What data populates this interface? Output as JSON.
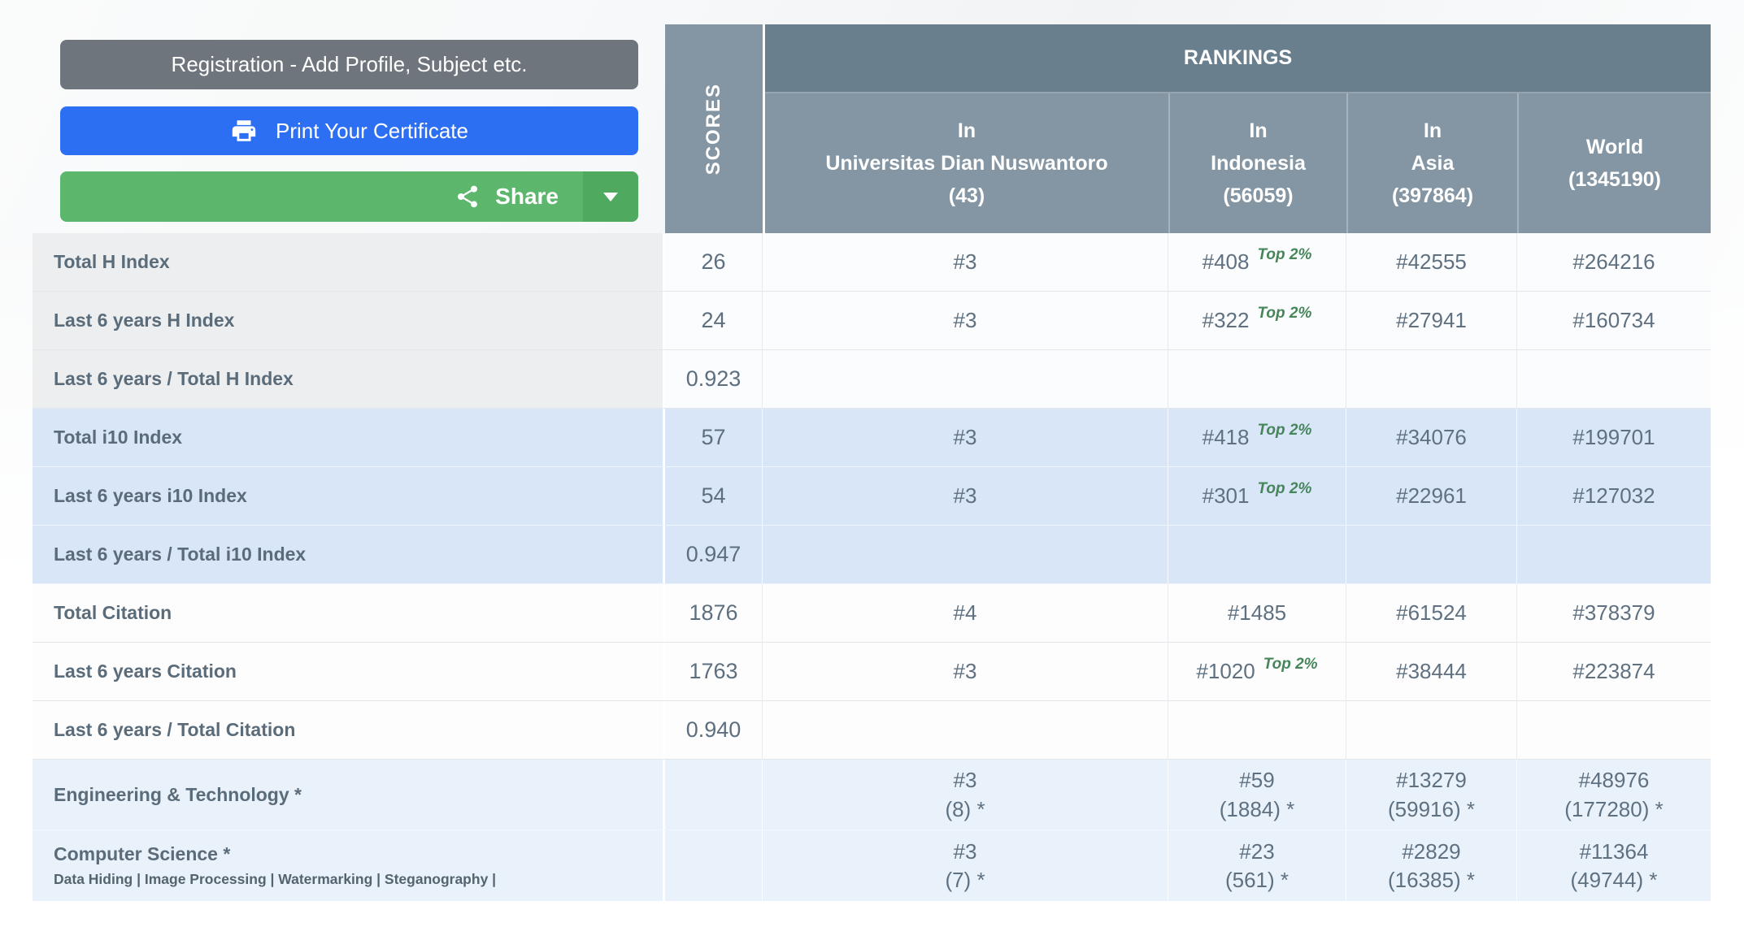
{
  "buttons": {
    "registration": "Registration - Add Profile, Subject etc.",
    "print": "Print Your Certificate",
    "share": "Share"
  },
  "icons": {
    "printer": "printer-icon",
    "share": "share-nodes-icon",
    "caret": "chevron-down-icon"
  },
  "colors": {
    "button_gray": "#6e757c",
    "button_blue": "#2c6ff2",
    "button_green": "#5cb66c",
    "button_green_dark": "#4fa95e",
    "header_dark_slate": "#6a7f8e",
    "header_light_slate": "#8496a3",
    "row_blue": "#d9e6f8",
    "row_light_blue": "#e9f1fb",
    "row_gray": "#eceef0",
    "badge_green": "#47855a",
    "text_slate": "#5a6b7a"
  },
  "table": {
    "scores_header": "SCORES",
    "rankings_header": "RANKINGS",
    "columns": [
      {
        "lines": [
          "In",
          "Universitas Dian Nuswantoro",
          "(43)"
        ]
      },
      {
        "lines": [
          "In",
          "Indonesia",
          "(56059)"
        ]
      },
      {
        "lines": [
          "In",
          "Asia",
          "(397864)"
        ]
      },
      {
        "lines": [
          "World",
          "(1345190)"
        ]
      }
    ],
    "rows": [
      {
        "group": "h",
        "label": "Total H Index",
        "score": "26",
        "cells": [
          {
            "rank": "#3"
          },
          {
            "rank": "#408",
            "badge": "Top 2%"
          },
          {
            "rank": "#42555"
          },
          {
            "rank": "#264216"
          }
        ]
      },
      {
        "group": "h",
        "label": "Last 6 years H Index",
        "score": "24",
        "cells": [
          {
            "rank": "#3"
          },
          {
            "rank": "#322",
            "badge": "Top 2%"
          },
          {
            "rank": "#27941"
          },
          {
            "rank": "#160734"
          }
        ]
      },
      {
        "group": "h",
        "label": "Last 6 years / Total H Index",
        "score": "0.923",
        "cells": [
          {},
          {},
          {},
          {}
        ]
      },
      {
        "group": "i10",
        "label": "Total i10 Index",
        "score": "57",
        "cells": [
          {
            "rank": "#3"
          },
          {
            "rank": "#418",
            "badge": "Top 2%"
          },
          {
            "rank": "#34076"
          },
          {
            "rank": "#199701"
          }
        ]
      },
      {
        "group": "i10",
        "label": "Last 6 years i10 Index",
        "score": "54",
        "cells": [
          {
            "rank": "#3"
          },
          {
            "rank": "#301",
            "badge": "Top 2%"
          },
          {
            "rank": "#22961"
          },
          {
            "rank": "#127032"
          }
        ]
      },
      {
        "group": "i10",
        "label": "Last 6 years / Total i10 Index",
        "score": "0.947",
        "cells": [
          {},
          {},
          {},
          {}
        ]
      },
      {
        "group": "cit",
        "label": "Total Citation",
        "score": "1876",
        "cells": [
          {
            "rank": "#4"
          },
          {
            "rank": "#1485"
          },
          {
            "rank": "#61524"
          },
          {
            "rank": "#378379"
          }
        ]
      },
      {
        "group": "cit",
        "label": "Last 6 years Citation",
        "score": "1763",
        "cells": [
          {
            "rank": "#3"
          },
          {
            "rank": "#1020",
            "badge": "Top 2%"
          },
          {
            "rank": "#38444"
          },
          {
            "rank": "#223874"
          }
        ]
      },
      {
        "group": "cit",
        "label": "Last 6 years / Total Citation",
        "score": "0.940",
        "cells": [
          {},
          {},
          {},
          {}
        ]
      },
      {
        "group": "subj",
        "label": "Engineering & Technology *",
        "score": "",
        "cells": [
          {
            "rank": "#3",
            "line2": "(8) *"
          },
          {
            "rank": "#59",
            "line2": "(1884) *"
          },
          {
            "rank": "#13279",
            "line2": "(59916) *"
          },
          {
            "rank": "#48976",
            "line2": "(177280) *"
          }
        ]
      },
      {
        "group": "subj",
        "label": "Computer Science *",
        "sublabel": "Data Hiding | Image Processing | Watermarking | Steganography |",
        "score": "",
        "cells": [
          {
            "rank": "#3",
            "line2": "(7) *"
          },
          {
            "rank": "#23",
            "line2": "(561) *"
          },
          {
            "rank": "#2829",
            "line2": "(16385) *"
          },
          {
            "rank": "#11364",
            "line2": "(49744) *"
          }
        ]
      }
    ]
  }
}
